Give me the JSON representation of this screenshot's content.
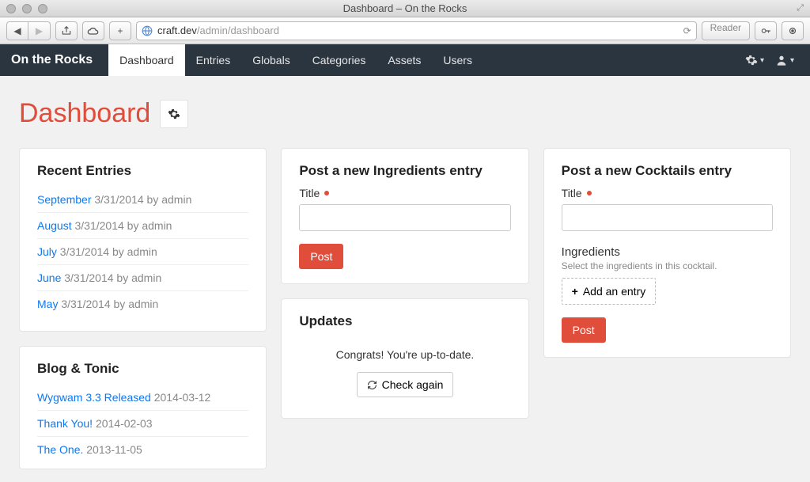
{
  "window": {
    "title": "Dashboard – On the Rocks"
  },
  "browser": {
    "url_host": "craft.dev",
    "url_path": "/admin/dashboard",
    "reader_label": "Reader"
  },
  "nav": {
    "brand": "On the Rocks",
    "tabs": [
      {
        "label": "Dashboard",
        "active": true
      },
      {
        "label": "Entries",
        "active": false
      },
      {
        "label": "Globals",
        "active": false
      },
      {
        "label": "Categories",
        "active": false
      },
      {
        "label": "Assets",
        "active": false
      },
      {
        "label": "Users",
        "active": false
      }
    ]
  },
  "page": {
    "title": "Dashboard"
  },
  "recent_entries": {
    "heading": "Recent Entries",
    "items": [
      {
        "title": "September",
        "meta": "3/31/2014 by admin"
      },
      {
        "title": "August",
        "meta": "3/31/2014 by admin"
      },
      {
        "title": "July",
        "meta": "3/31/2014 by admin"
      },
      {
        "title": "June",
        "meta": "3/31/2014 by admin"
      },
      {
        "title": "May",
        "meta": "3/31/2014 by admin"
      }
    ]
  },
  "blog_tonic": {
    "heading": "Blog & Tonic",
    "items": [
      {
        "title": "Wygwam 3.3 Released",
        "meta": "2014-03-12"
      },
      {
        "title": "Thank You!",
        "meta": "2014-02-03"
      },
      {
        "title": "The One.",
        "meta": "2013-11-05"
      }
    ]
  },
  "ingredients_form": {
    "heading": "Post a new Ingredients entry",
    "title_label": "Title",
    "post_label": "Post"
  },
  "updates": {
    "heading": "Updates",
    "message": "Congrats! You're up-to-date.",
    "button": "Check again"
  },
  "cocktails_form": {
    "heading": "Post a new Cocktails entry",
    "title_label": "Title",
    "ingredients_label": "Ingredients",
    "ingredients_help": "Select the ingredients in this cocktail.",
    "add_entry_label": "Add an entry",
    "post_label": "Post"
  }
}
